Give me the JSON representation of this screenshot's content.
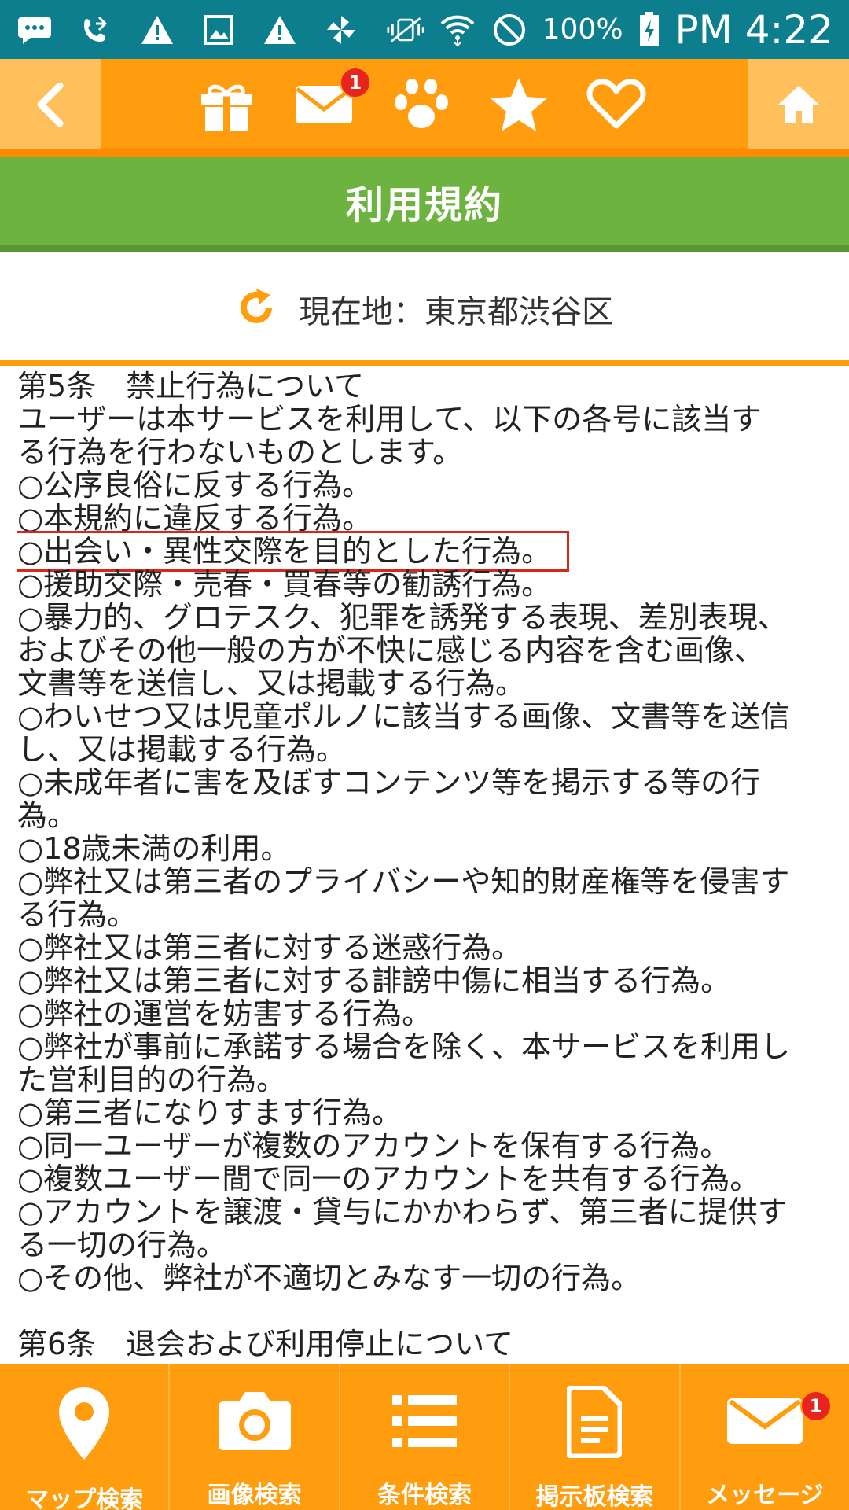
{
  "status_bar": {
    "battery": "100%",
    "time": "PM 4:22",
    "icons": [
      "message-icon",
      "call-forward-icon",
      "warning-icon",
      "image-icon",
      "warning-icon",
      "pinwheel-icon",
      "vibrate-mute-icon",
      "wifi-icon",
      "block-icon",
      "battery-charging-icon"
    ]
  },
  "top_nav": {
    "icons": [
      "back-arrow-icon",
      "gift-icon",
      "mail-icon",
      "paw-icon",
      "star-icon",
      "heart-icon",
      "home-icon"
    ],
    "mail_badge": "1"
  },
  "title": "利用規約",
  "location": {
    "text": "現在地：東京都渋谷区",
    "icon": "refresh-icon"
  },
  "content": {
    "lines": [
      "第5条　禁止行為について",
      "ユーザーは本サービスを利用して、以下の各号に該当す",
      "る行為を行わないものとします。",
      "○公序良俗に反する行為。",
      "○本規約に違反する行為。",
      "○出会い・異性交際を目的とした行為。",
      "○援助交際・売春・買春等の勧誘行為。",
      "○暴力的、グロテスク、犯罪を誘発する表現、差別表現、",
      "およびその他一般の方が不快に感じる内容を含む画像、",
      "文書等を送信し、又は掲載する行為。",
      "○わいせつ又は児童ポルノに該当する画像、文書等を送信",
      "し、又は掲載する行為。",
      "○未成年者に害を及ぼすコンテンツ等を掲示する等の行",
      "為。",
      "○18歳未満の利用。",
      "○弊社又は第三者のプライバシーや知的財産権等を侵害す",
      "る行為。",
      "○弊社又は第三者に対する迷惑行為。",
      "○弊社又は第三者に対する誹謗中傷に相当する行為。",
      "○弊社の運営を妨害する行為。",
      "○弊社が事前に承諾する場合を除く、本サービスを利用し",
      "た営利目的の行為。",
      "○第三者になりすます行為。",
      "○同一ユーザーが複数のアカウントを保有する行為。",
      "○複数ユーザー間で同一のアカウントを共有する行為。",
      "○アカウントを譲渡・貸与にかかわらず、第三者に提供す",
      "る一切の行為。",
      "○その他、弊社が不適切とみなす一切の行為。",
      "",
      "第6条　退会および利用停止について"
    ]
  },
  "bottom_nav": {
    "items": [
      {
        "label": "マップ検索",
        "icon": "map-pin-icon"
      },
      {
        "label": "画像検索",
        "icon": "camera-icon"
      },
      {
        "label": "条件検索",
        "icon": "list-icon"
      },
      {
        "label": "掲示板検索",
        "icon": "document-icon"
      },
      {
        "label": "メッセージ",
        "icon": "mail-icon"
      }
    ],
    "message_badge": "1"
  },
  "colors": {
    "status_bar": "#0d7e8e",
    "nav_orange": "#ff9d0f",
    "nav_light": "#ffbf5a",
    "title_green": "#6db33f",
    "badge_red": "#e8241f",
    "highlight_red": "#d9261c"
  }
}
